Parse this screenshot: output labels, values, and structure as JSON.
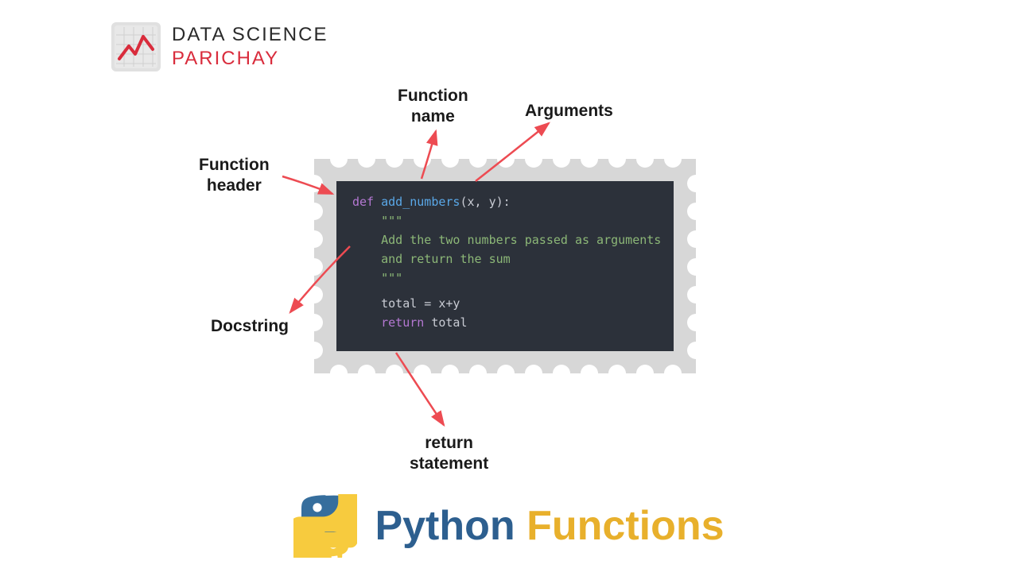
{
  "logo": {
    "line1": "DATA SCIENCE",
    "line2": "PARICHAY"
  },
  "labels": {
    "function_name": "Function\nname",
    "arguments": "Arguments",
    "function_header": "Function\nheader",
    "docstring": "Docstring",
    "return_statement": "return\nstatement"
  },
  "code": {
    "line1": {
      "kw": "def ",
      "fn": "add_numbers",
      "params": "(x, y):"
    },
    "line2": {
      "str": "    \"\"\""
    },
    "line3": {
      "str": "    Add the two numbers passed as arguments"
    },
    "line4": {
      "str": "    and return the sum"
    },
    "line5": {
      "str": "    \"\"\""
    },
    "line6": {
      "var": "    total = x+y"
    },
    "line7": {
      "kw": "    return ",
      "var": "total"
    }
  },
  "title": {
    "w1": "Python ",
    "w2": "Functions"
  },
  "colors": {
    "red_arrow": "#ed4b52",
    "code_bg": "#2c313a",
    "stamp": "#d7d7d7",
    "brand_red": "#d92c3c",
    "title_blue": "#2d5f8f",
    "title_yellow": "#e8b02c",
    "python_blue": "#366e9d",
    "python_yellow": "#f7cb3e"
  }
}
